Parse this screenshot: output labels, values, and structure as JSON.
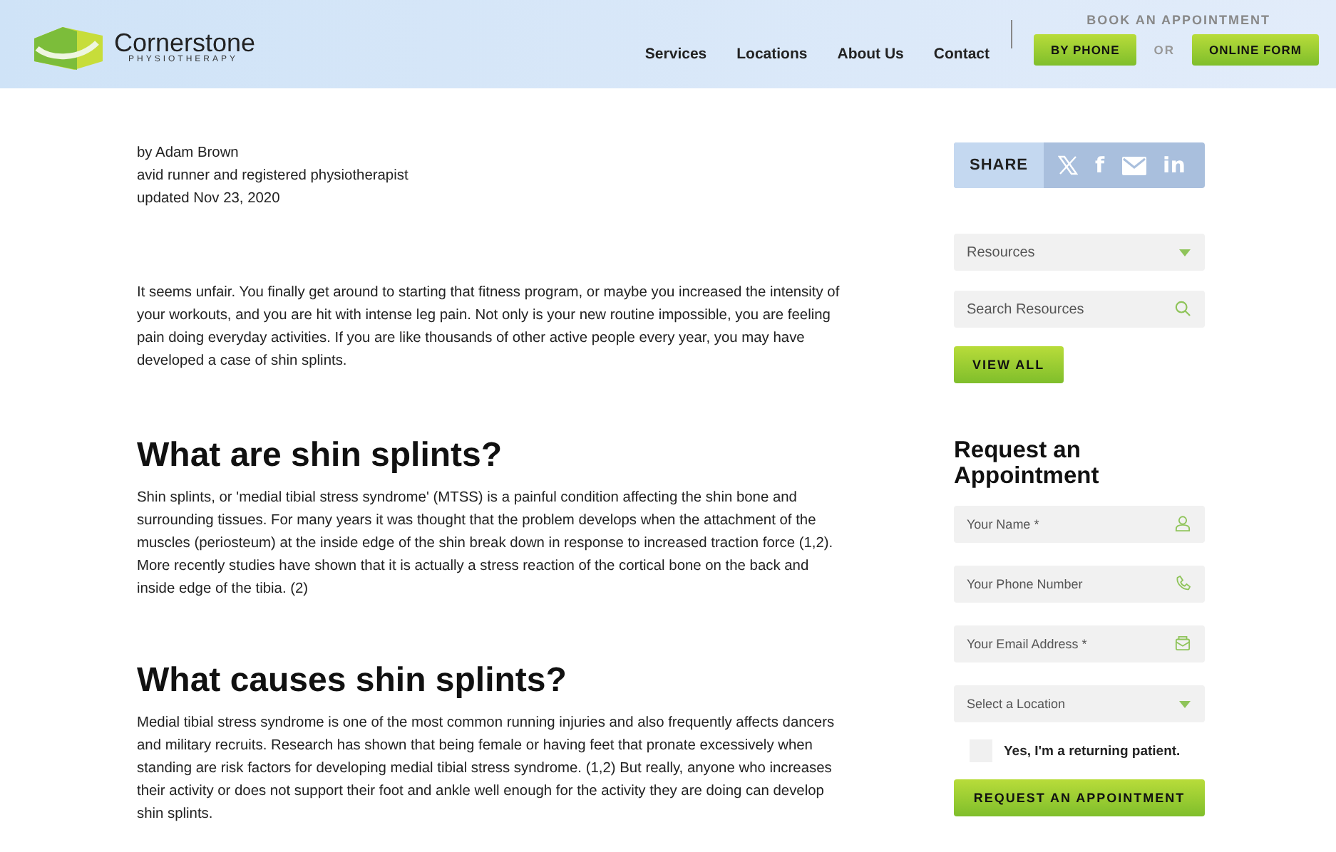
{
  "header": {
    "logo": {
      "name": "Cornerstone",
      "tagline": "PHYSIOTHERAPY"
    },
    "nav": [
      "Services",
      "Locations",
      "About Us",
      "Contact"
    ],
    "booking": {
      "title": "BOOK AN APPOINTMENT",
      "phone_button": "BY PHONE",
      "separator": "OR",
      "form_button": "ONLINE FORM"
    }
  },
  "article": {
    "byline": [
      "by Adam Brown",
      "avid runner and registered physiotherapist",
      "updated Nov 23, 2020"
    ],
    "sections": [
      {
        "paragraph": "It seems unfair. You finally get around to starting that fitness program, or maybe you increased the intensity of your workouts, and you are hit with intense leg pain. Not only is your new routine impossible, you are feeling pain doing everyday activities. If you are like thousands of other active people every year, you may have developed a case of shin splints."
      },
      {
        "heading": "What are shin splints?",
        "paragraph": "Shin splints, or 'medial tibial stress syndrome'  (MTSS) is a painful condition affecting the shin bone and surrounding tissues. For many years it was thought that the problem develops when the attachment of the muscles (periosteum) at the inside edge of the shin break down in response to increased traction force (1,2). More recently studies have shown that it is actually a stress reaction of the cortical bone on the back and inside edge of the tibia. (2)"
      },
      {
        "heading": "What causes shin splints?",
        "paragraph": "Medial tibial stress syndrome is one of the most common running injuries and also frequently affects dancers and military recruits. Research has shown that being female or having feet that pronate excessively when standing are risk factors for developing medial tibial stress syndrome. (1,2) But really, anyone who increases their activity or does not support their foot and ankle well enough for the activity they are doing can develop shin splints."
      }
    ]
  },
  "sidebar": {
    "share": {
      "label": "SHARE",
      "facebook": "f",
      "linkedin": "in"
    },
    "resources_select": "Resources",
    "search": {
      "placeholder": "Search Resources"
    },
    "view_all": "VIEW ALL",
    "form": {
      "title": "Request an Appointment",
      "fields": [
        {
          "kind": "name",
          "placeholder": "Your Name *"
        },
        {
          "kind": "phone",
          "placeholder": "Your Phone Number"
        },
        {
          "kind": "email",
          "placeholder": "Your Email Address *"
        },
        {
          "kind": "select",
          "placeholder": "Select a Location"
        }
      ],
      "returning_patient": {
        "label": "Yes, I'm a returning patient.",
        "checked": false
      },
      "submit": "REQUEST AN APPOINTMENT"
    }
  }
}
